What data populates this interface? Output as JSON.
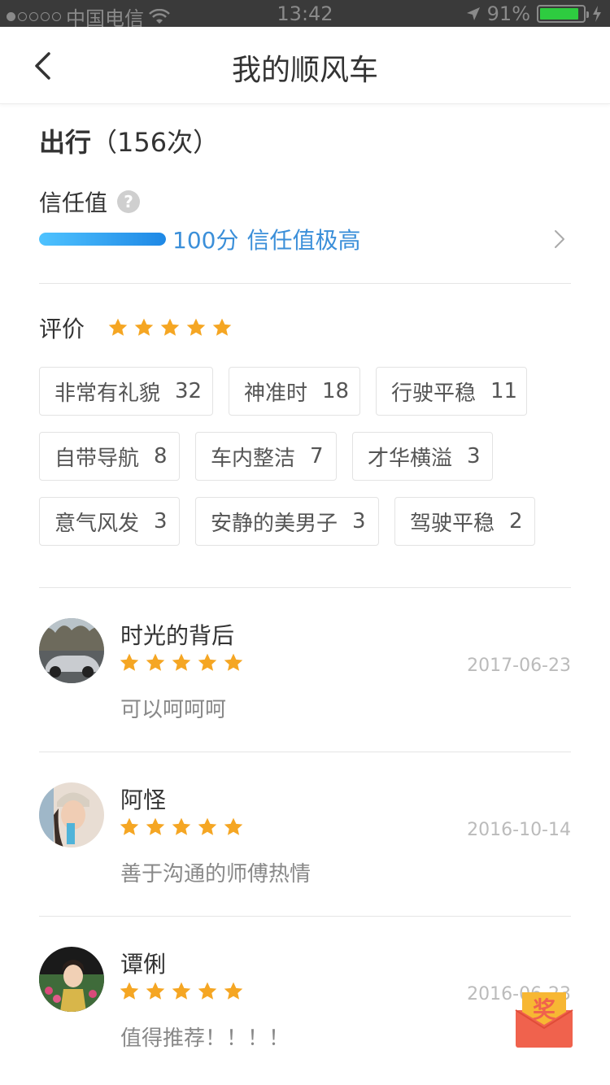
{
  "status_bar": {
    "carrier": "中国电信",
    "time": "13:42",
    "battery": "91%",
    "battery_level": 0.91,
    "signal_bars": 1
  },
  "nav": {
    "title": "我的顺风车",
    "back_icon": "chevron-left-icon"
  },
  "trips": {
    "label": "出行",
    "count_text": "（156次）"
  },
  "trust": {
    "label": "信任值",
    "help_icon": "question-icon",
    "score_text": "100分",
    "level_text": "信任值极高",
    "level_fraction": 1.0,
    "arrow_icon": "chevron-right-icon"
  },
  "rating": {
    "label": "评价",
    "stars": 5,
    "star_color": "#f5a623"
  },
  "tags": [
    {
      "label": "非常有礼貌",
      "count": "32"
    },
    {
      "label": "神准时",
      "count": "18"
    },
    {
      "label": "行驶平稳",
      "count": "11"
    },
    {
      "label": "自带导航",
      "count": "8"
    },
    {
      "label": "车内整洁",
      "count": "7"
    },
    {
      "label": "才华横溢",
      "count": "3"
    },
    {
      "label": "意气风发",
      "count": "3"
    },
    {
      "label": "安静的美男子",
      "count": "3"
    },
    {
      "label": "驾驶平稳",
      "count": "2"
    }
  ],
  "reviews": [
    {
      "name": "时光的背后",
      "stars": 5,
      "date": "2017-06-23",
      "text": "可以呵呵呵"
    },
    {
      "name": "阿怪",
      "stars": 5,
      "date": "2016-10-14",
      "text": "善于沟通的师傅热情"
    },
    {
      "name": "谭俐",
      "stars": 5,
      "date": "2016-06-23",
      "text": "值得推荐！！！！"
    }
  ],
  "reward_badge": {
    "label": "奖",
    "icon": "red-envelope-icon"
  },
  "colors": {
    "accent_blue": "#3b8fd9",
    "star_orange": "#f5a623",
    "reward_red": "#f0624d"
  }
}
